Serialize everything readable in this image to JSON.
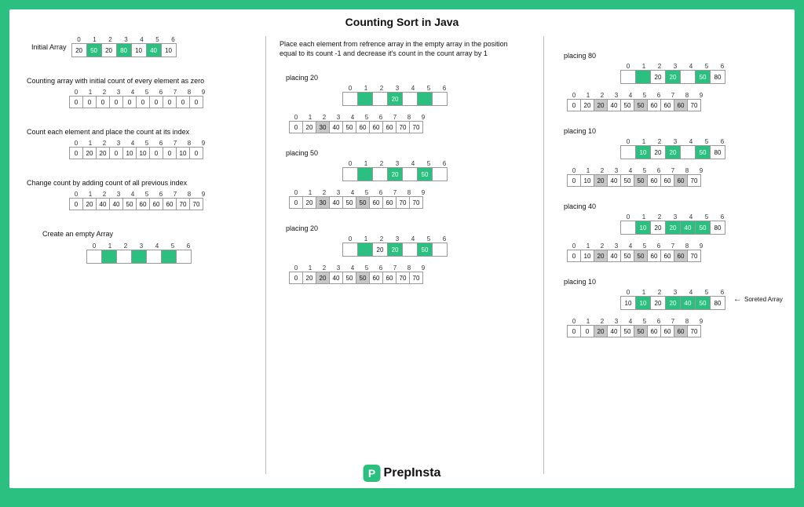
{
  "title": "Counting Sort in Java",
  "logo": "PrepInsta",
  "col1": {
    "initial_label": "Initial Array",
    "initial_idx": [
      "0",
      "1",
      "2",
      "3",
      "4",
      "5",
      "6"
    ],
    "initial_vals": [
      "20",
      "50",
      "20",
      "80",
      "10",
      "40",
      "10"
    ],
    "initial_hl": [
      0,
      1,
      0,
      1,
      0,
      1,
      0
    ],
    "zero_label": "Counting array with initial count of every element as zero",
    "zero_idx": [
      "0",
      "1",
      "2",
      "3",
      "4",
      "5",
      "6",
      "7",
      "8",
      "9"
    ],
    "zero_vals": [
      "0",
      "0",
      "0",
      "0",
      "0",
      "0",
      "0",
      "0",
      "0",
      "0"
    ],
    "count_label": "Count each element and place the count at its index",
    "count_idx": [
      "0",
      "1",
      "2",
      "3",
      "4",
      "5",
      "6",
      "7",
      "8",
      "9"
    ],
    "count_vals": [
      "0",
      "20",
      "20",
      "0",
      "10",
      "10",
      "0",
      "0",
      "10",
      "0"
    ],
    "cum_label": "Change count by adding count of all previous index",
    "cum_idx": [
      "0",
      "1",
      "2",
      "3",
      "4",
      "5",
      "6",
      "7",
      "8",
      "9"
    ],
    "cum_vals": [
      "0",
      "20",
      "40",
      "40",
      "50",
      "60",
      "60",
      "60",
      "70",
      "70"
    ],
    "empty_label": "Create an empty Array",
    "empty_idx": [
      "0",
      "1",
      "2",
      "3",
      "4",
      "5",
      "6"
    ],
    "empty_hl": [
      0,
      1,
      0,
      1,
      0,
      1,
      0
    ]
  },
  "col2": {
    "intro": "Place each element from refrence array in the empty array in the position equal to its count -1 and decrease it's count in the count array by 1",
    "steps": [
      {
        "label": "placing 20",
        "out_idx": [
          "0",
          "1",
          "2",
          "3",
          "4",
          "5",
          "6"
        ],
        "out_vals": [
          "",
          "",
          "",
          "20",
          "",
          "",
          ""
        ],
        "out_hl": [
          0,
          1,
          0,
          1,
          0,
          1,
          0
        ],
        "cnt_idx": [
          "0",
          "1",
          "2",
          "3",
          "4",
          "5",
          "6",
          "7",
          "8",
          "9"
        ],
        "cnt_vals": [
          "0",
          "20",
          "30",
          "40",
          "50",
          "60",
          "60",
          "60",
          "70",
          "70"
        ],
        "cnt_grey": [
          0,
          0,
          1,
          0,
          0,
          0,
          0,
          0,
          0,
          0
        ]
      },
      {
        "label": "placing 50",
        "out_idx": [
          "0",
          "1",
          "2",
          "3",
          "4",
          "5",
          "6"
        ],
        "out_vals": [
          "",
          "",
          "",
          "20",
          "",
          "50",
          ""
        ],
        "out_hl": [
          0,
          1,
          0,
          1,
          0,
          1,
          0
        ],
        "cnt_idx": [
          "0",
          "1",
          "2",
          "3",
          "4",
          "5",
          "6",
          "7",
          "8",
          "9"
        ],
        "cnt_vals": [
          "0",
          "20",
          "30",
          "40",
          "50",
          "50",
          "60",
          "60",
          "70",
          "70"
        ],
        "cnt_grey": [
          0,
          0,
          1,
          0,
          0,
          1,
          0,
          0,
          0,
          0
        ]
      },
      {
        "label": "placing 20",
        "out_idx": [
          "0",
          "1",
          "2",
          "3",
          "4",
          "5",
          "6"
        ],
        "out_vals": [
          "",
          "",
          "20",
          "20",
          "",
          "50",
          ""
        ],
        "out_hl": [
          0,
          1,
          0,
          1,
          0,
          1,
          0
        ],
        "cnt_idx": [
          "0",
          "1",
          "2",
          "3",
          "4",
          "5",
          "6",
          "7",
          "8",
          "9"
        ],
        "cnt_vals": [
          "0",
          "20",
          "20",
          "40",
          "50",
          "50",
          "60",
          "60",
          "70",
          "70"
        ],
        "cnt_grey": [
          0,
          0,
          1,
          0,
          0,
          1,
          0,
          0,
          0,
          0
        ]
      }
    ]
  },
  "col3": {
    "steps": [
      {
        "label": "placing 80",
        "out_idx": [
          "0",
          "1",
          "2",
          "3",
          "4",
          "5",
          "6"
        ],
        "out_vals": [
          "",
          "",
          "20",
          "20",
          "",
          "50",
          "80"
        ],
        "out_hl": [
          0,
          1,
          0,
          1,
          0,
          1,
          0
        ],
        "cnt_idx": [
          "0",
          "1",
          "2",
          "3",
          "4",
          "5",
          "6",
          "7",
          "8",
          "9"
        ],
        "cnt_vals": [
          "0",
          "20",
          "20",
          "40",
          "50",
          "50",
          "60",
          "60",
          "60",
          "70"
        ],
        "cnt_grey": [
          0,
          0,
          1,
          0,
          0,
          1,
          0,
          0,
          1,
          0
        ]
      },
      {
        "label": "placing 10",
        "out_idx": [
          "0",
          "1",
          "2",
          "3",
          "4",
          "5",
          "6"
        ],
        "out_vals": [
          "",
          "10",
          "20",
          "20",
          "",
          "50",
          "80"
        ],
        "out_hl": [
          0,
          1,
          0,
          1,
          0,
          1,
          0
        ],
        "cnt_idx": [
          "0",
          "1",
          "2",
          "3",
          "4",
          "5",
          "6",
          "7",
          "8",
          "9"
        ],
        "cnt_vals": [
          "0",
          "10",
          "20",
          "40",
          "50",
          "50",
          "60",
          "60",
          "60",
          "70"
        ],
        "cnt_grey": [
          0,
          0,
          1,
          0,
          0,
          1,
          0,
          0,
          1,
          0
        ]
      },
      {
        "label": "placing 40",
        "out_idx": [
          "0",
          "1",
          "2",
          "3",
          "4",
          "5",
          "6"
        ],
        "out_vals": [
          "",
          "10",
          "20",
          "20",
          "40",
          "50",
          "80"
        ],
        "out_hl": [
          0,
          1,
          0,
          1,
          1,
          1,
          0
        ],
        "cnt_idx": [
          "0",
          "1",
          "2",
          "3",
          "4",
          "5",
          "6",
          "7",
          "8",
          "9"
        ],
        "cnt_vals": [
          "0",
          "10",
          "20",
          "40",
          "50",
          "50",
          "60",
          "60",
          "60",
          "70"
        ],
        "cnt_grey": [
          0,
          0,
          1,
          0,
          0,
          1,
          0,
          0,
          1,
          0
        ]
      },
      {
        "label": "placing 10",
        "sorted_label": "Soreted Array",
        "out_idx": [
          "0",
          "1",
          "2",
          "3",
          "4",
          "5",
          "6"
        ],
        "out_vals": [
          "10",
          "10",
          "20",
          "20",
          "40",
          "50",
          "80"
        ],
        "out_hl": [
          0,
          1,
          0,
          1,
          1,
          1,
          0
        ],
        "cnt_idx": [
          "0",
          "1",
          "2",
          "3",
          "4",
          "5",
          "6",
          "7",
          "8",
          "9"
        ],
        "cnt_vals": [
          "0",
          "0",
          "20",
          "40",
          "50",
          "50",
          "60",
          "60",
          "60",
          "70"
        ],
        "cnt_grey": [
          0,
          0,
          1,
          0,
          0,
          1,
          0,
          0,
          1,
          0
        ]
      }
    ]
  }
}
